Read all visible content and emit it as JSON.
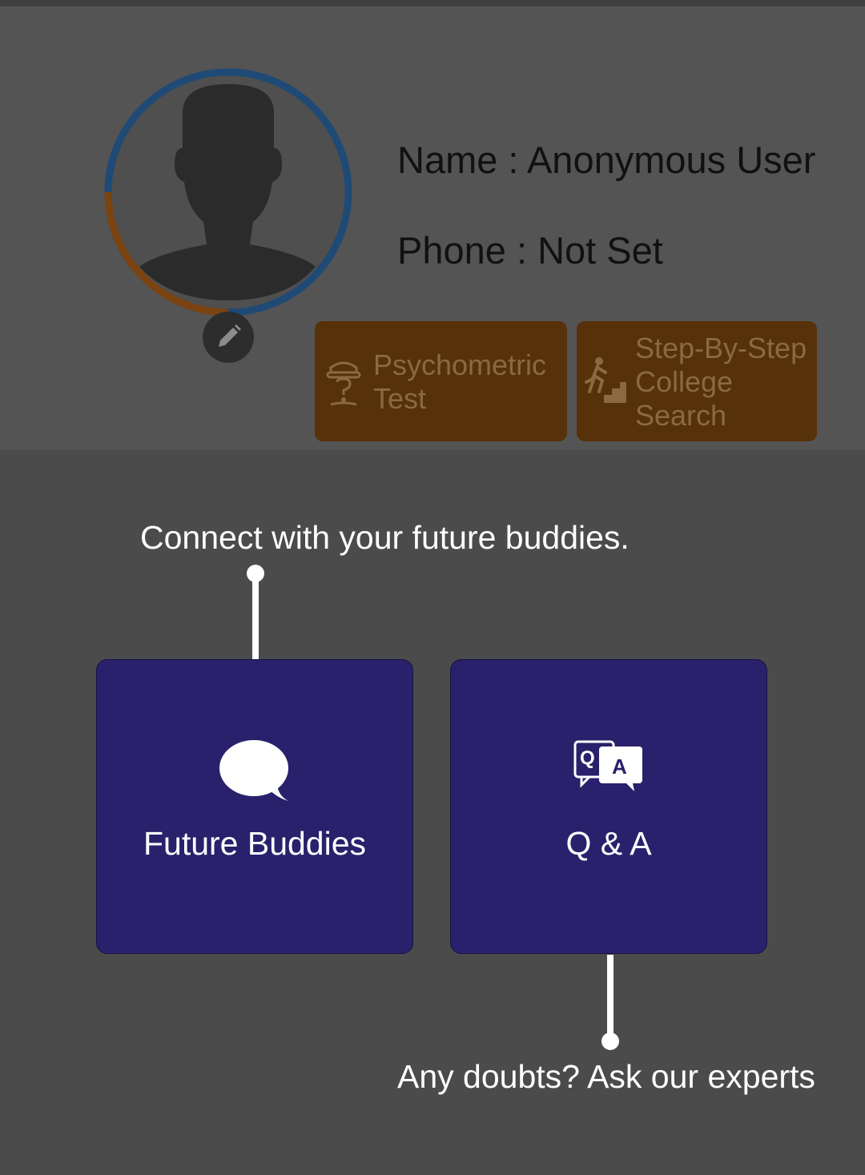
{
  "profile": {
    "name_line": "Name : Anonymous User",
    "phone_line": "Phone : Not Set",
    "avatar_icon": "person-silhouette-icon",
    "edit_icon": "pencil-icon",
    "profile_progress": 0.3
  },
  "actions": [
    {
      "label": "Psychometric\nTest",
      "icon": "detective-hat-icon"
    },
    {
      "label": "Step-By-Step\nCollege\nSearch",
      "icon": "person-climbing-stairs-icon"
    }
  ],
  "features": [
    {
      "label": "Future Buddies",
      "icon": "chat-bubble-icon",
      "hint": "Connect with your future buddies."
    },
    {
      "label": "Q & A",
      "icon": "qa-bubbles-icon",
      "hint": "Any doubts? Ask our experts"
    }
  ],
  "colors": {
    "overlay_background": "#4b4b4c",
    "header_background": "#545454",
    "action_button": "#573109",
    "feature_card": "#29216b",
    "progress_ring": "#1f4a75",
    "progress_fill": "#7a4310"
  }
}
